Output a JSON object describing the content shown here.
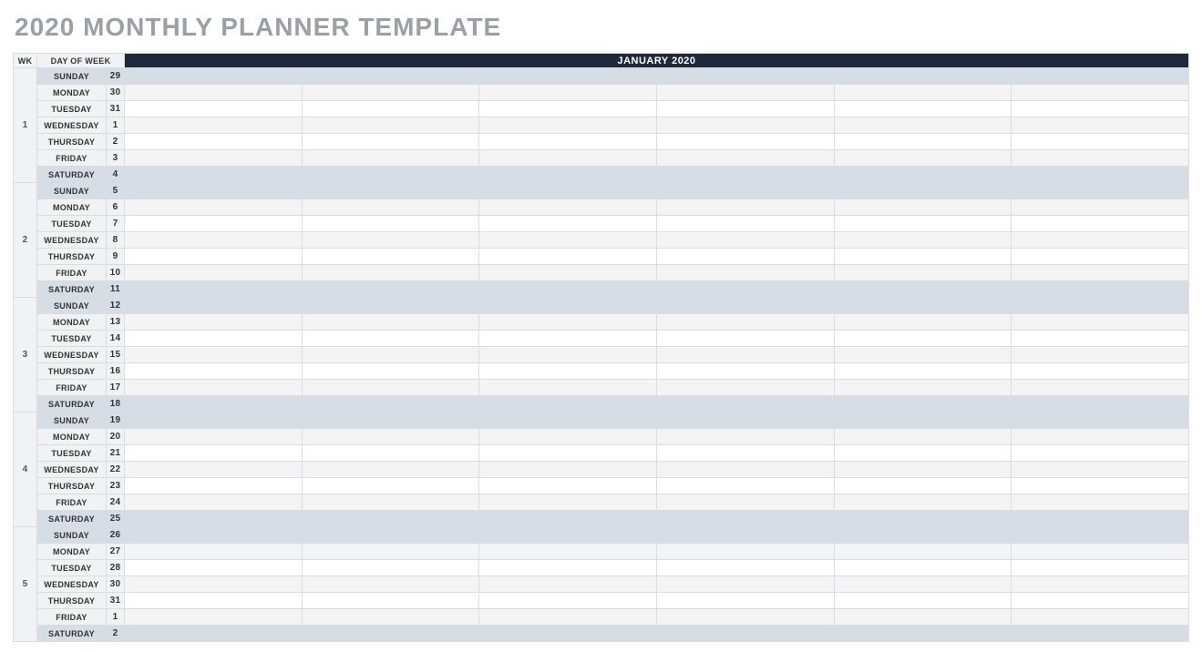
{
  "title": "2020 MONTHLY PLANNER TEMPLATE",
  "headers": {
    "wk": "WK",
    "dow": "DAY OF WEEK",
    "month": "JANUARY 2020"
  },
  "slots_per_row": 6,
  "weeks": [
    {
      "number": "1",
      "days": [
        {
          "dow": "SUNDAY",
          "date": "29",
          "weekend": true
        },
        {
          "dow": "MONDAY",
          "date": "30",
          "weekend": false
        },
        {
          "dow": "TUESDAY",
          "date": "31",
          "weekend": false
        },
        {
          "dow": "WEDNESDAY",
          "date": "1",
          "weekend": false
        },
        {
          "dow": "THURSDAY",
          "date": "2",
          "weekend": false
        },
        {
          "dow": "FRIDAY",
          "date": "3",
          "weekend": false
        },
        {
          "dow": "SATURDAY",
          "date": "4",
          "weekend": true
        }
      ]
    },
    {
      "number": "2",
      "days": [
        {
          "dow": "SUNDAY",
          "date": "5",
          "weekend": true
        },
        {
          "dow": "MONDAY",
          "date": "6",
          "weekend": false
        },
        {
          "dow": "TUESDAY",
          "date": "7",
          "weekend": false
        },
        {
          "dow": "WEDNESDAY",
          "date": "8",
          "weekend": false
        },
        {
          "dow": "THURSDAY",
          "date": "9",
          "weekend": false
        },
        {
          "dow": "FRIDAY",
          "date": "10",
          "weekend": false
        },
        {
          "dow": "SATURDAY",
          "date": "11",
          "weekend": true
        }
      ]
    },
    {
      "number": "3",
      "days": [
        {
          "dow": "SUNDAY",
          "date": "12",
          "weekend": true
        },
        {
          "dow": "MONDAY",
          "date": "13",
          "weekend": false
        },
        {
          "dow": "TUESDAY",
          "date": "14",
          "weekend": false
        },
        {
          "dow": "WEDNESDAY",
          "date": "15",
          "weekend": false
        },
        {
          "dow": "THURSDAY",
          "date": "16",
          "weekend": false
        },
        {
          "dow": "FRIDAY",
          "date": "17",
          "weekend": false
        },
        {
          "dow": "SATURDAY",
          "date": "18",
          "weekend": true
        }
      ]
    },
    {
      "number": "4",
      "days": [
        {
          "dow": "SUNDAY",
          "date": "19",
          "weekend": true
        },
        {
          "dow": "MONDAY",
          "date": "20",
          "weekend": false
        },
        {
          "dow": "TUESDAY",
          "date": "21",
          "weekend": false
        },
        {
          "dow": "WEDNESDAY",
          "date": "22",
          "weekend": false
        },
        {
          "dow": "THURSDAY",
          "date": "23",
          "weekend": false
        },
        {
          "dow": "FRIDAY",
          "date": "24",
          "weekend": false
        },
        {
          "dow": "SATURDAY",
          "date": "25",
          "weekend": true
        }
      ]
    },
    {
      "number": "5",
      "days": [
        {
          "dow": "SUNDAY",
          "date": "26",
          "weekend": true
        },
        {
          "dow": "MONDAY",
          "date": "27",
          "weekend": false
        },
        {
          "dow": "TUESDAY",
          "date": "28",
          "weekend": false
        },
        {
          "dow": "WEDNESDAY",
          "date": "30",
          "weekend": false
        },
        {
          "dow": "THURSDAY",
          "date": "31",
          "weekend": false
        },
        {
          "dow": "FRIDAY",
          "date": "1",
          "weekend": false
        },
        {
          "dow": "SATURDAY",
          "date": "2",
          "weekend": true
        }
      ]
    }
  ]
}
